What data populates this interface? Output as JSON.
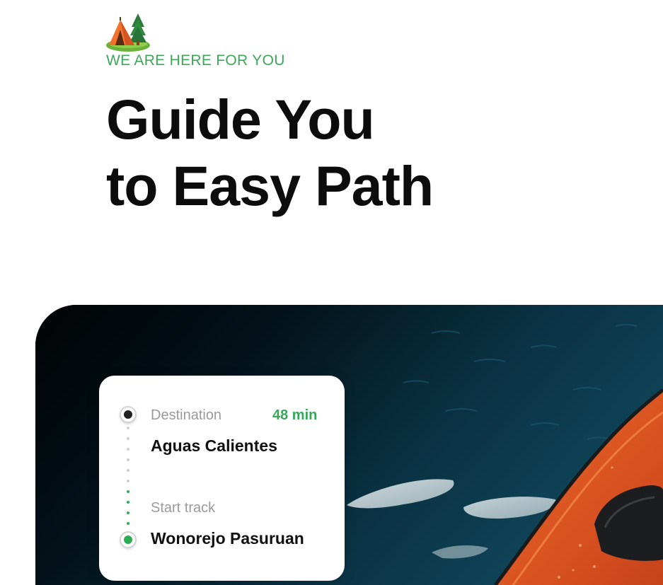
{
  "hero": {
    "icon": "camping-tent-icon",
    "eyebrow": "WE ARE HERE FOR YOU",
    "title_line1": "Guide You",
    "title_line2": "to Easy Path"
  },
  "route_card": {
    "destination_label": "Destination",
    "duration": "48 min",
    "destination_name": "Aguas Calientes",
    "start_label": "Start track",
    "start_name": "Wonorejo Pasuruan"
  },
  "image": {
    "subject": "kayak-on-lake-photo"
  },
  "colors": {
    "accent_green": "#3ea75a",
    "title_text": "#0c0c0c",
    "kayak_orange": "#e4521f"
  }
}
